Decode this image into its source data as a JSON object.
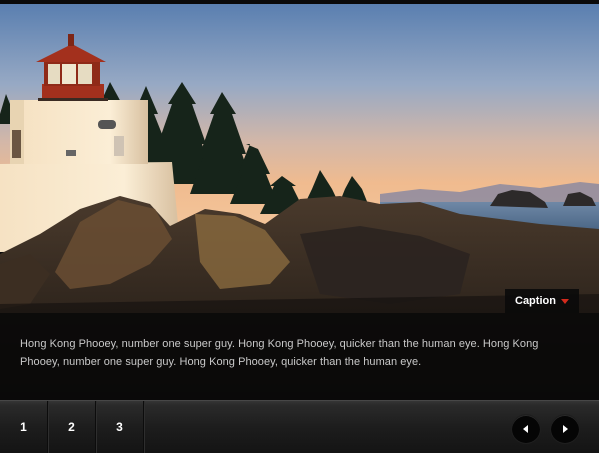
{
  "slide": {
    "image": "lighthouse-on-rocky-coast-at-sunset",
    "caption_toggle_label": "Caption",
    "caption_text": "Hong Kong Phooey, number one super guy. Hong Kong Phooey, quicker than the human eye. Hong Kong Phooey, number one super guy. Hong Kong Phooey, quicker than the human eye."
  },
  "pagination": {
    "pages": [
      "1",
      "2",
      "3"
    ],
    "active_page": "1"
  },
  "controls": {
    "prev_icon": "chevron-left-icon",
    "next_icon": "chevron-right-icon"
  },
  "colors": {
    "caption_arrow": "#d32a1c",
    "nav_background": "#1d1d1d",
    "caption_background": "#080808"
  }
}
